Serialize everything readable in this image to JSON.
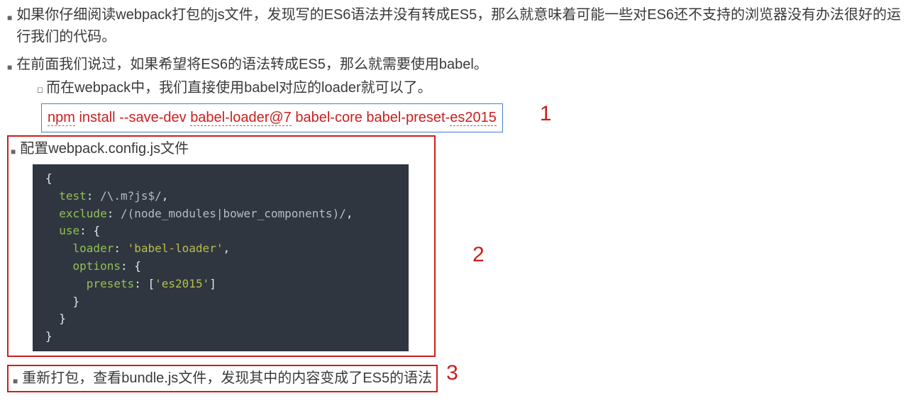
{
  "bullets": {
    "b1": "如果你仔细阅读webpack打包的js文件，发现写的ES6语法并没有转成ES5，那么就意味着可能一些对ES6还不支持的浏览器没有办法很好的运行我们的代码。",
    "b2": "在前面我们说过，如果希望将ES6的语法转成ES5，那么就需要使用babel。",
    "b2_sub": "而在webpack中，我们直接使用babel对应的loader就可以了。",
    "b3": "配置webpack.config.js文件",
    "b4": "重新打包，查看bundle.js文件，发现其中的内容变成了ES5的语法"
  },
  "install_cmd": {
    "p1": "npm",
    "p2": " install --save-dev ",
    "p3": "babel-loader@7",
    "p4": " babel-core babel-preset-",
    "p5": "es2015"
  },
  "annotations": {
    "n1": "1",
    "n2": "2",
    "n3": "3"
  },
  "code": {
    "l1_a": "{",
    "l2_k": "test",
    "l2_p": ": ",
    "l2_r": "/\\.m?js$/",
    "l2_c": ",",
    "l3_k": "exclude",
    "l3_p": ": ",
    "l3_r": "/(node_modules|bower_components)/",
    "l3_c": ",",
    "l4_k": "use",
    "l4_p": ": {",
    "l5_k": "loader",
    "l5_p": ": ",
    "l5_s": "'babel-loader'",
    "l5_c": ",",
    "l6_k": "options",
    "l6_p": ": {",
    "l7_k": "presets",
    "l7_p": ": [",
    "l7_s": "'es2015'",
    "l7_c": "]",
    "l8_a": "}",
    "l9_a": "}",
    "l10_a": "}"
  }
}
